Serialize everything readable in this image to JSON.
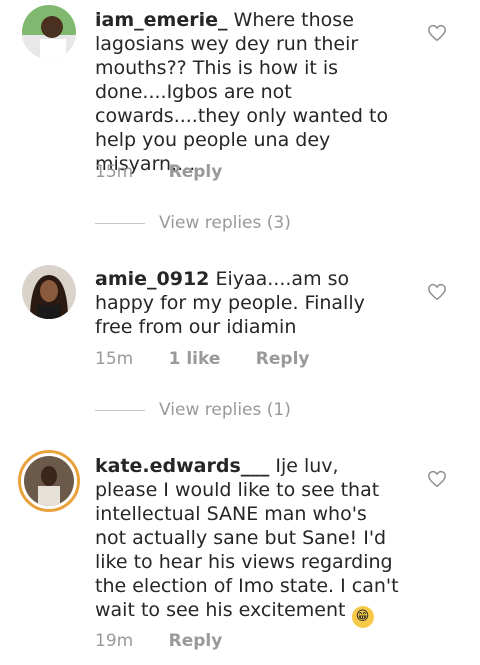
{
  "comments": [
    {
      "username": "iam_emerie_",
      "text": "Where those lagosians wey dey run their mouths?? This is how it is done....Igbos are not cowards....they only wanted to help you people una dey misyarn....",
      "time": "15m",
      "likes": "",
      "reply_label": "Reply",
      "view_replies": "View replies (3)"
    },
    {
      "username": "amie_0912",
      "text": "Eiyaa....am so happy for my people. Finally free from our idiamin",
      "time": "15m",
      "likes": "1 like",
      "reply_label": "Reply",
      "view_replies": "View replies (1)"
    },
    {
      "username": "kate.edwards___",
      "text": "Ije luv, please I would like to see that intellectual SANE man who's not actually sane but Sane! I'd like to hear his views regarding the election of Imo state. I can't wait to see his excitement",
      "emoji": "😁",
      "time": "19m",
      "likes": "",
      "reply_label": "Reply",
      "view_replies": ""
    }
  ],
  "colors": {
    "text": "#262626",
    "muted": "#999999",
    "story_ring": "#e9a23b"
  }
}
